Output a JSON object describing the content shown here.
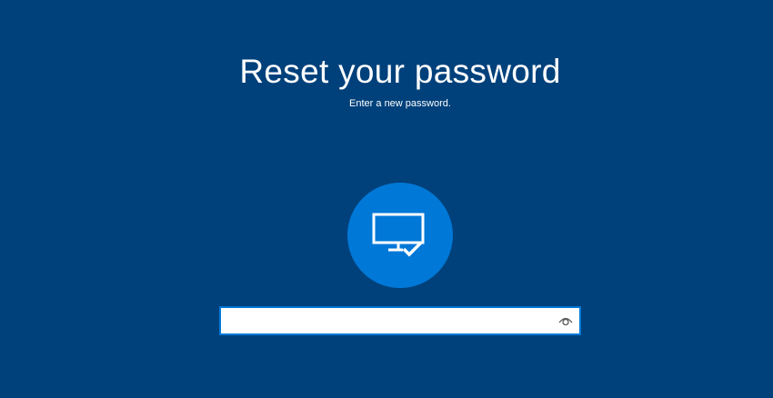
{
  "header": {
    "title": "Reset your password",
    "subtitle": "Enter a new password."
  },
  "avatar": {
    "icon": "monitor-check-icon"
  },
  "password_field": {
    "value": "",
    "placeholder": "",
    "reveal_icon": "eye-icon"
  },
  "colors": {
    "background": "#00417b",
    "accent": "#0078d7",
    "text": "#ffffff"
  }
}
